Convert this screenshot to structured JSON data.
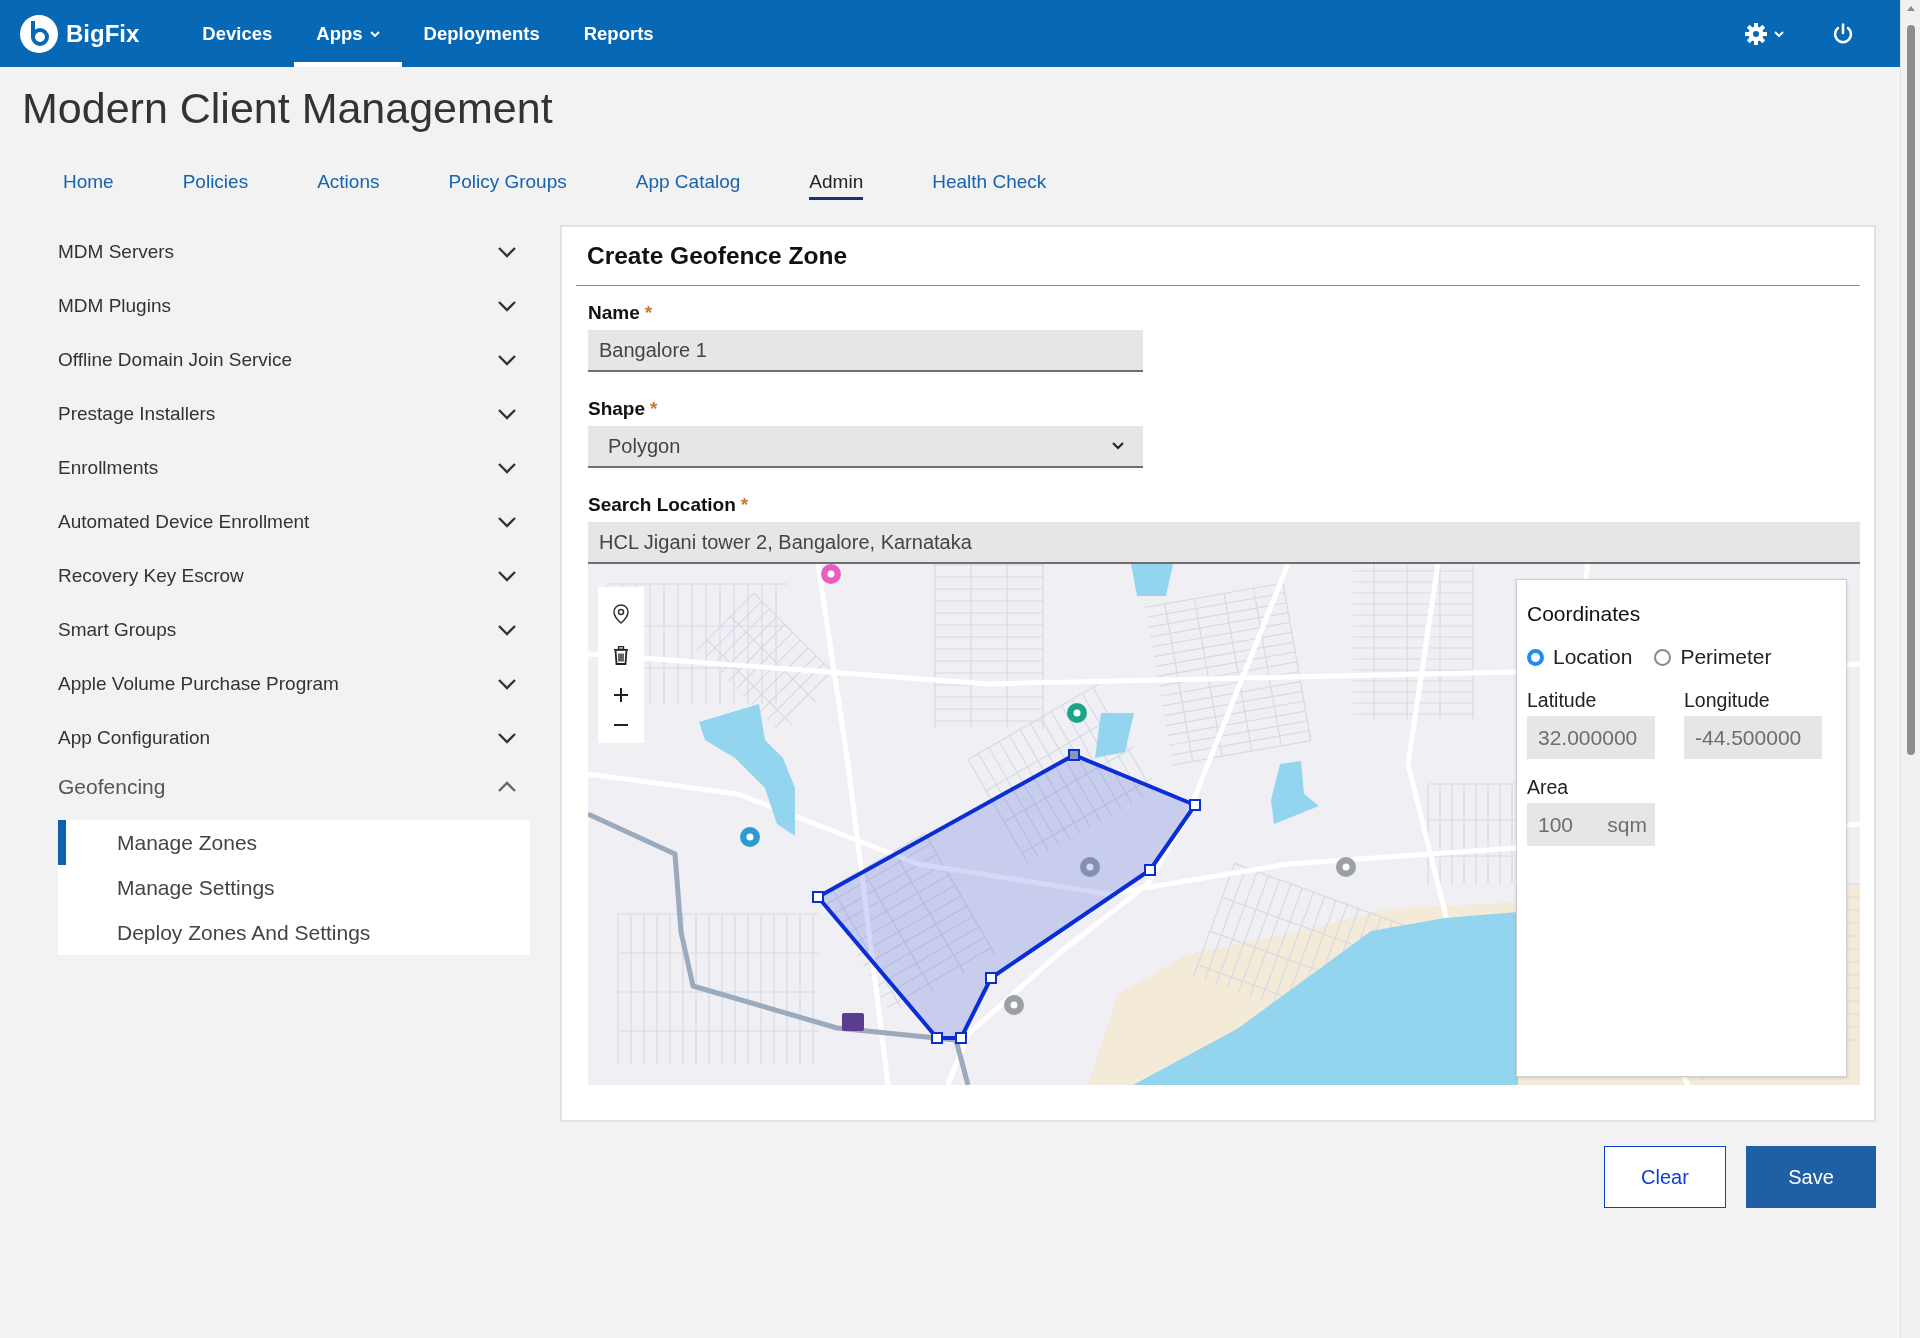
{
  "top_bar": {
    "brand": "BigFix",
    "nav": [
      {
        "label": "Devices",
        "selected": false,
        "has_menu": false
      },
      {
        "label": "Apps",
        "selected": true,
        "has_menu": true
      },
      {
        "label": "Deployments",
        "selected": false,
        "has_menu": false
      },
      {
        "label": "Reports",
        "selected": false,
        "has_menu": false
      }
    ]
  },
  "page_title": "Modern Client Management",
  "tabs": [
    {
      "label": "Home",
      "selected": false
    },
    {
      "label": "Policies",
      "selected": false
    },
    {
      "label": "Actions",
      "selected": false
    },
    {
      "label": "Policy Groups",
      "selected": false
    },
    {
      "label": "App Catalog",
      "selected": false
    },
    {
      "label": "Admin",
      "selected": true
    },
    {
      "label": "Health Check",
      "selected": false
    }
  ],
  "sidebar": {
    "items": [
      {
        "label": "MDM Servers",
        "expanded": false
      },
      {
        "label": "MDM Plugins",
        "expanded": false
      },
      {
        "label": "Offline Domain Join Service",
        "expanded": false
      },
      {
        "label": "Prestage Installers",
        "expanded": false
      },
      {
        "label": "Enrollments",
        "expanded": false
      },
      {
        "label": "Automated Device Enrollment",
        "expanded": false
      },
      {
        "label": "Recovery Key Escrow",
        "expanded": false
      },
      {
        "label": "Smart Groups",
        "expanded": false
      },
      {
        "label": "Apple Volume Purchase Program",
        "expanded": false
      },
      {
        "label": "App Configuration",
        "expanded": false
      },
      {
        "label": "Geofencing",
        "expanded": true,
        "children": [
          {
            "label": "Manage Zones",
            "selected": true
          },
          {
            "label": "Manage Settings",
            "selected": false
          },
          {
            "label": "Deploy Zones And Settings",
            "selected": false
          }
        ]
      }
    ]
  },
  "form": {
    "title": "Create Geofence Zone",
    "fields": [
      {
        "kind": "text",
        "label": "Name",
        "required_mark": "*",
        "value": "Bangalore 1"
      },
      {
        "kind": "select",
        "label": "Shape",
        "required_mark": "*",
        "value": "Polygon"
      },
      {
        "kind": "search",
        "label": "Search Location",
        "required_mark": "*",
        "value": "HCL Jigani tower 2, Bangalore, Karnataka"
      }
    ]
  },
  "map": {
    "coordinates": {
      "title": "Coordinates",
      "modes": [
        {
          "label": "Location",
          "selected": true
        },
        {
          "label": "Perimeter",
          "selected": false
        }
      ],
      "fields": [
        {
          "kind": "number",
          "label": "Latitude",
          "value": "32.000000",
          "disabled": true
        },
        {
          "kind": "number",
          "label": "Longitude",
          "value": "-44.500000",
          "disabled": true
        },
        {
          "kind": "measure",
          "label": "Area",
          "value": "100",
          "unit": "sqm",
          "disabled": true
        }
      ]
    }
  },
  "buttons": [
    {
      "label": "Clear",
      "kind": "secondary"
    },
    {
      "label": "Save",
      "kind": "primary"
    }
  ]
}
